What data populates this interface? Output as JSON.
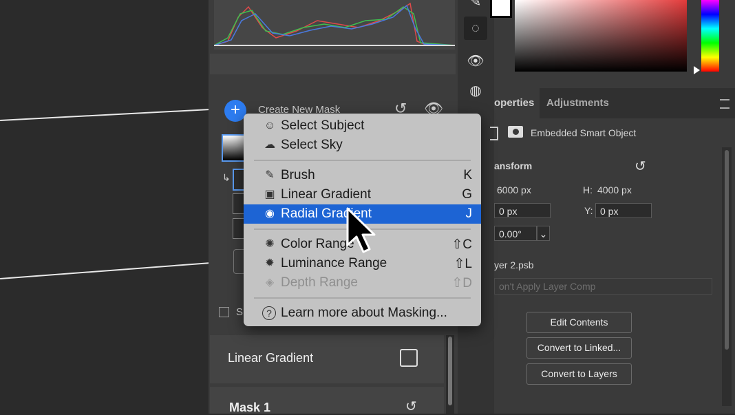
{
  "masks_panel": {
    "create_new_mask": "Create New Mask",
    "checkbox_label": "S",
    "list": [
      {
        "label": "Linear Gradient"
      },
      {
        "label": "Mask 1"
      }
    ]
  },
  "menu": {
    "items": [
      {
        "icon": "select-subject-icon",
        "glyph": "☺",
        "label": "Select Subject",
        "shortcut": ""
      },
      {
        "icon": "select-sky-icon",
        "glyph": "☁",
        "label": "Select Sky",
        "shortcut": ""
      },
      {
        "icon": "brush-icon",
        "glyph": "✎",
        "label": "Brush",
        "shortcut": "K"
      },
      {
        "icon": "linear-gradient-icon",
        "glyph": "▣",
        "label": "Linear Gradient",
        "shortcut": "G"
      },
      {
        "icon": "radial-gradient-icon",
        "glyph": "◉",
        "label": "Radial Gradient",
        "shortcut": "J"
      },
      {
        "icon": "color-range-icon",
        "glyph": "✺",
        "label": "Color Range",
        "shortcut": "⇧C"
      },
      {
        "icon": "luminance-range-icon",
        "glyph": "✹",
        "label": "Luminance Range",
        "shortcut": "⇧L"
      },
      {
        "icon": "depth-range-icon",
        "glyph": "◈",
        "label": "Depth Range",
        "shortcut": "⇧D"
      },
      {
        "icon": "help-icon",
        "glyph": "?",
        "label": "Learn more about Masking...",
        "shortcut": ""
      }
    ],
    "highlighted": "Radial Gradient",
    "disabled": "Depth Range"
  },
  "properties": {
    "tabs": [
      "operties",
      "Adjustments"
    ],
    "object_type": "Embedded Smart Object",
    "section": "ansform",
    "w_value": "6000 px",
    "h_label": "H:",
    "h_value": "4000 px",
    "x_value": "0 px",
    "y_label": "Y:",
    "y_value": "0 px",
    "angle_value": "0.00°",
    "filename": "yer 2.psb",
    "layer_comp": "on't Apply Layer Comp",
    "buttons": {
      "edit_contents": "Edit Contents",
      "convert_linked": "Convert to Linked...",
      "convert_layers": "Convert to Layers"
    }
  },
  "colors": {
    "accent": "#2d7cf0",
    "menu_highlight": "#1d64d4",
    "menu_bg": "#c3c3c3"
  }
}
